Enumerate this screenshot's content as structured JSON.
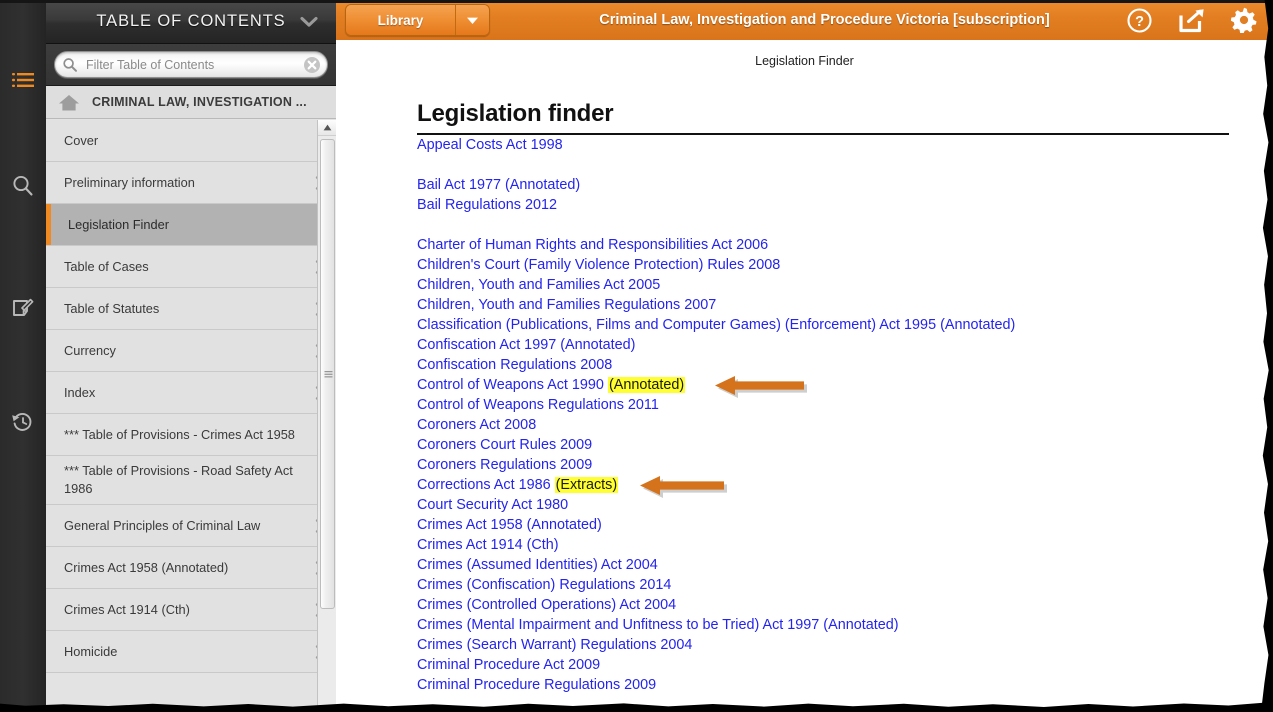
{
  "colors": {
    "accent_orange": "#e37f22",
    "highlight_yellow": "#ffff2f",
    "link_blue": "#2424ee",
    "rail_dark": "#2b2b2b",
    "selected_gray": "#b2b2b2",
    "arrow_orange": "#d4731c"
  },
  "rail": {
    "items": [
      {
        "name": "toc-icon",
        "label": "Table of Contents",
        "active": true
      },
      {
        "name": "search-icon",
        "label": "Search",
        "active": false
      },
      {
        "name": "notes-icon",
        "label": "Notes",
        "active": false
      },
      {
        "name": "history-icon",
        "label": "History",
        "active": false
      }
    ]
  },
  "toc": {
    "title": "TABLE OF CONTENTS",
    "collapse_icon": "chevron-down-icon",
    "filter": {
      "placeholder": "Filter Table of Contents",
      "value": "",
      "search_icon": "search-icon",
      "clear_icon": "clear-icon"
    },
    "breadcrumb": {
      "home_icon": "home-icon",
      "label": "CRIMINAL LAW, INVESTIGATION ..."
    },
    "items": [
      {
        "label": "Cover",
        "expandable": false,
        "selected": false
      },
      {
        "label": "Preliminary information",
        "expandable": true,
        "selected": false
      },
      {
        "label": "Legislation Finder",
        "expandable": false,
        "selected": true
      },
      {
        "label": "Table of Cases",
        "expandable": true,
        "selected": false
      },
      {
        "label": "Table of Statutes",
        "expandable": true,
        "selected": false
      },
      {
        "label": "Currency",
        "expandable": true,
        "selected": false
      },
      {
        "label": "Index",
        "expandable": true,
        "selected": false
      },
      {
        "label": "*** Table of Provisions - Crimes Act 1958",
        "expandable": false,
        "selected": false
      },
      {
        "label": "*** Table of Provisions - Road Safety Act 1986",
        "expandable": false,
        "selected": false
      },
      {
        "label": "General Principles of Criminal Law",
        "expandable": true,
        "selected": false
      },
      {
        "label": "Crimes Act 1958 (Annotated)",
        "expandable": true,
        "selected": false
      },
      {
        "label": "Crimes Act 1914 (Cth)",
        "expandable": true,
        "selected": false
      },
      {
        "label": "Homicide",
        "expandable": true,
        "selected": false
      }
    ]
  },
  "topbar": {
    "library_label": "Library",
    "library_caret_icon": "caret-down-icon",
    "document_title": "Criminal Law, Investigation and Procedure Victoria [subscription]",
    "actions": [
      {
        "name": "help-icon",
        "label": "Help"
      },
      {
        "name": "share-icon",
        "label": "Share"
      },
      {
        "name": "gear-icon",
        "label": "Settings"
      }
    ]
  },
  "content": {
    "running_head": "Legislation Finder",
    "heading": "Legislation finder",
    "groups": [
      {
        "links": [
          {
            "text": "Appeal Costs Act 1998"
          }
        ]
      },
      {
        "links": [
          {
            "text": "Bail Act 1977 (Annotated)"
          },
          {
            "text": "Bail Regulations 2012"
          }
        ]
      },
      {
        "links": [
          {
            "text": "Charter of Human Rights and Responsibilities Act 2006"
          },
          {
            "text": "Children's Court (Family Violence Protection) Rules 2008"
          },
          {
            "text": "Children, Youth and Families Act 2005"
          },
          {
            "text": "Children, Youth and Families Regulations 2007"
          },
          {
            "text": "Classification (Publications, Films and Computer Games) (Enforcement) Act 1995 (Annotated)"
          },
          {
            "text": "Confiscation Act 1997 (Annotated)"
          },
          {
            "text": "Confiscation Regulations 2008"
          },
          {
            "text": "Control of Weapons Act 1990 ",
            "highlight": "(Annotated)",
            "annotated_arrow": true
          },
          {
            "text": "Control of Weapons Regulations 2011"
          },
          {
            "text": "Coroners Act 2008"
          },
          {
            "text": "Coroners Court Rules 2009"
          },
          {
            "text": "Coroners Regulations 2009"
          },
          {
            "text": "Corrections Act 1986 ",
            "highlight": "(Extracts)",
            "annotated_arrow": true
          },
          {
            "text": "Court Security Act 1980"
          },
          {
            "text": "Crimes Act 1958 (Annotated)"
          },
          {
            "text": "Crimes Act 1914 (Cth)"
          },
          {
            "text": "Crimes (Assumed Identities) Act 2004"
          },
          {
            "text": "Crimes (Confiscation) Regulations 2014"
          },
          {
            "text": "Crimes (Controlled Operations) Act 2004"
          },
          {
            "text": "Crimes (Mental Impairment and Unfitness to be Tried) Act 1997 (Annotated)"
          },
          {
            "text": "Crimes (Search Warrant) Regulations 2004"
          },
          {
            "text": "Criminal Procedure Act 2009"
          },
          {
            "text": "Criminal Procedure Regulations 2009"
          }
        ]
      }
    ]
  }
}
